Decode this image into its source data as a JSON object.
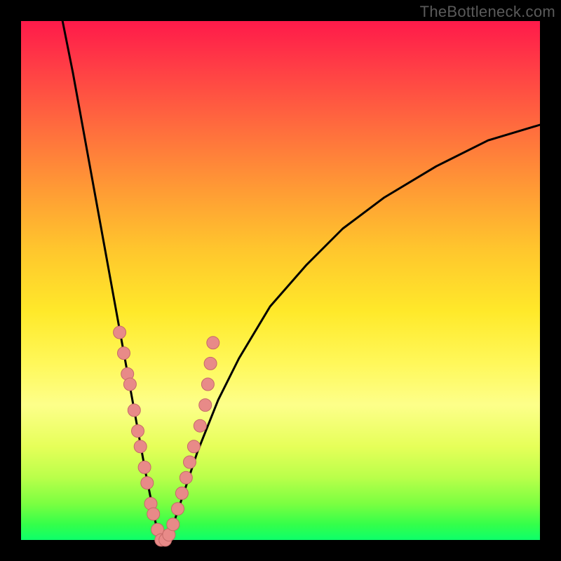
{
  "watermark": "TheBottleneck.com",
  "colors": {
    "frame": "#000000",
    "curve": "#000000",
    "marker_fill": "#e88a88",
    "marker_stroke": "#c56a68",
    "gradient_stops": [
      "#ff1a4a",
      "#ff6a3e",
      "#ffc62d",
      "#fff85a",
      "#b9ff4a",
      "#0dff6a"
    ]
  },
  "chart_data": {
    "type": "line",
    "title": "",
    "xlabel": "",
    "ylabel": "",
    "xlim": [
      0,
      100
    ],
    "ylim": [
      0,
      100
    ],
    "note": "V-shaped bottleneck curve; y≈0 near x≈27, rising steeply for x<27 and gradually for x>27. Salmon markers cluster near the valley on both branches.",
    "series": [
      {
        "name": "bottleneck-curve",
        "x": [
          8,
          10,
          12,
          14,
          16,
          18,
          20,
          22,
          24,
          25,
          26,
          27,
          28,
          29,
          30,
          32,
          34,
          38,
          42,
          48,
          55,
          62,
          70,
          80,
          90,
          100
        ],
        "y": [
          100,
          90,
          79,
          68,
          57,
          46,
          35,
          24,
          13,
          8,
          3,
          0,
          0,
          2,
          5,
          11,
          17,
          27,
          35,
          45,
          53,
          60,
          66,
          72,
          77,
          80
        ]
      }
    ],
    "markers": [
      {
        "x": 19.0,
        "y": 40
      },
      {
        "x": 19.8,
        "y": 36
      },
      {
        "x": 20.5,
        "y": 32
      },
      {
        "x": 21.0,
        "y": 30
      },
      {
        "x": 21.8,
        "y": 25
      },
      {
        "x": 22.5,
        "y": 21
      },
      {
        "x": 23.0,
        "y": 18
      },
      {
        "x": 23.8,
        "y": 14
      },
      {
        "x": 24.3,
        "y": 11
      },
      {
        "x": 25.0,
        "y": 7
      },
      {
        "x": 25.5,
        "y": 5
      },
      {
        "x": 26.3,
        "y": 2
      },
      {
        "x": 27.0,
        "y": 0
      },
      {
        "x": 27.8,
        "y": 0
      },
      {
        "x": 28.5,
        "y": 1
      },
      {
        "x": 29.3,
        "y": 3
      },
      {
        "x": 30.2,
        "y": 6
      },
      {
        "x": 31.0,
        "y": 9
      },
      {
        "x": 31.8,
        "y": 12
      },
      {
        "x": 32.5,
        "y": 15
      },
      {
        "x": 33.3,
        "y": 18
      },
      {
        "x": 34.5,
        "y": 22
      },
      {
        "x": 35.5,
        "y": 26
      },
      {
        "x": 36.0,
        "y": 30
      },
      {
        "x": 36.5,
        "y": 34
      },
      {
        "x": 37.0,
        "y": 38
      }
    ]
  }
}
